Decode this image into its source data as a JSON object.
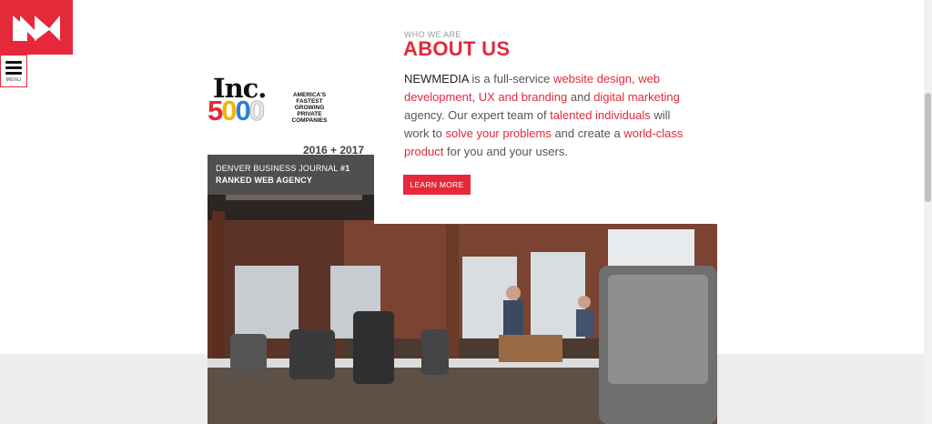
{
  "nav": {
    "menu_label": "MENU"
  },
  "about": {
    "eyebrow": "WHO WE ARE",
    "title": "ABOUT US",
    "body": {
      "brand": "NEWMEDIA",
      "t1": " is a full-service ",
      "h1": "website design",
      "t2": ", ",
      "h2": "web development",
      "t3": ", ",
      "h3": "UX and branding",
      "t4": " and ",
      "h4": "digital marketing",
      "t5": " agency. Our expert team of ",
      "h5": "talented individuals",
      "t6": " will work to ",
      "h6": "solve your problems",
      "t7": " and create a ",
      "h7": "world-class product",
      "t8": " for you and your users."
    },
    "cta_label": "LEARN MORE"
  },
  "award": {
    "inc_word": "Inc.",
    "inc_number": {
      "d1": "5",
      "d2": "0",
      "d3": "0",
      "d4": "0"
    },
    "tagline": [
      "AMERICA'S",
      "FASTEST",
      "GROWING",
      "PRIVATE",
      "COMPANIES"
    ],
    "years": "2016 + 2017"
  },
  "badge": {
    "line1_prefix": "DENVER BUSINESS JOURNAL ",
    "line1_bold": "#1",
    "line2": "RANKED WEB AGENCY"
  },
  "colors": {
    "accent": "#e5283a",
    "badge_bg": "#4f4f4f",
    "band_bg": "#ededed"
  }
}
